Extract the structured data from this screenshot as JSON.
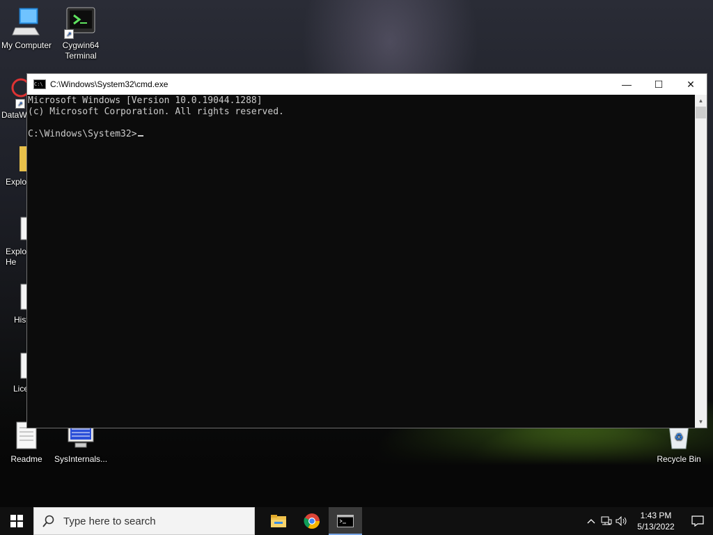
{
  "desktop": {
    "icons": [
      {
        "label": "My Computer"
      },
      {
        "label": "Cygwin64 Terminal"
      },
      {
        "label": "DataW"
      },
      {
        "label": "Explo"
      },
      {
        "label": "Explo He"
      },
      {
        "label": "Hist"
      },
      {
        "label": "Lice"
      },
      {
        "label": "Readme"
      },
      {
        "label": "SysInternals..."
      },
      {
        "label": "Recycle Bin"
      }
    ]
  },
  "cmd_window": {
    "title": "C:\\Windows\\System32\\cmd.exe",
    "minimize_label": "—",
    "maximize_label": "☐",
    "close_label": "✕",
    "console_lines": [
      "Microsoft Windows [Version 10.0.19044.1288]",
      "(c) Microsoft Corporation. All rights reserved.",
      "",
      "C:\\Windows\\System32>"
    ]
  },
  "taskbar": {
    "search_placeholder": "Type here to search",
    "apps": [
      {
        "name": "File Explorer",
        "icon": "folder-icon"
      },
      {
        "name": "Google Chrome",
        "icon": "chrome-icon"
      },
      {
        "name": "Command Prompt",
        "icon": "cmd-icon",
        "active": true
      }
    ],
    "clock": {
      "time": "1:43 PM",
      "date": "5/13/2022"
    }
  },
  "colors": {
    "console_bg": "#0c0c0c",
    "console_text": "#cccccc",
    "taskbar_bg": "#101010",
    "accent": "#7aa7e8"
  }
}
